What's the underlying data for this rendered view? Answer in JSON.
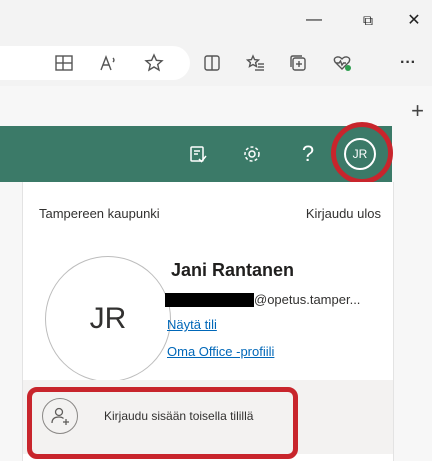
{
  "browser": {
    "window_controls": {
      "minimize": "—",
      "restore": "⧉",
      "close": "✕"
    },
    "toolbar_icons": [
      "grid-icon",
      "read-aloud-icon",
      "star-icon",
      "split-screen-icon",
      "favorites-icon",
      "collections-icon",
      "health-icon",
      "more-icon"
    ],
    "more_label": "···",
    "new_tab_label": "+"
  },
  "appbar": {
    "color": "#3b7a68",
    "help_label": "?",
    "avatar_initials": "JR"
  },
  "account": {
    "organization": "Tampereen kaupunki",
    "sign_out": "Kirjaudu ulos",
    "initials": "JR",
    "name": "Jani Rantanen",
    "email_visible": "@opetus.tamper...",
    "view_account": "Näytä tili",
    "office_profile": "Oma Office -profiili",
    "other_account": "Kirjaudu sisään toisella tilillä"
  },
  "highlight_color": "#c8252c"
}
